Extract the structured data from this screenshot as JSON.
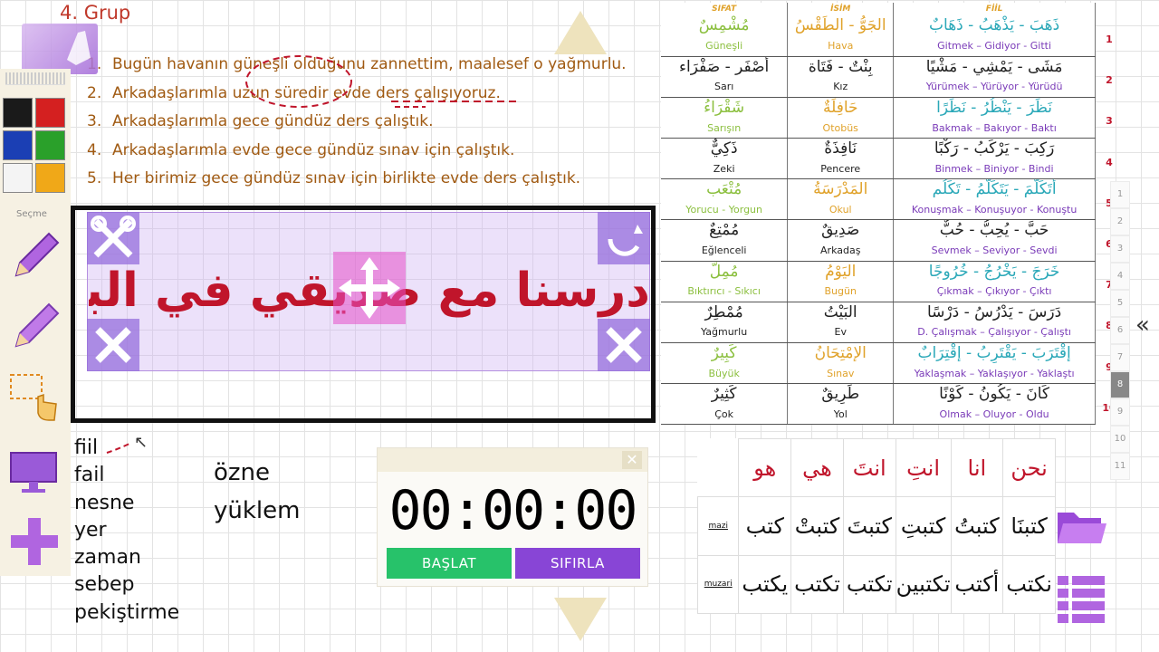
{
  "header": {
    "group_title": "4. Grup"
  },
  "sentences": [
    {
      "num": "1.",
      "text": "Bugün havanın güneşli olduğunu zannettim, maalesef o yağmurlu."
    },
    {
      "num": "2.",
      "text": "Arkadaşlarımla uzun süredir evde ders çalışıyoruz."
    },
    {
      "num": "3.",
      "text": "Arkadaşlarımla gece gündüz ders çalıştık."
    },
    {
      "num": "4.",
      "text": "Arkadaşlarımla evde gece gündüz sınav için çalıştık."
    },
    {
      "num": "5.",
      "text": "Her birimiz gece gündüz sınav için birlikte evde ders çalıştık."
    }
  ],
  "toolbar": {
    "secme_label": "Seçme",
    "colors": [
      "#1a1a1a",
      "#d42020",
      "#1b3fb4",
      "#2aa02a",
      "#f4f4f4",
      "#f0a818"
    ]
  },
  "panel": {
    "arabic_text": "درسنا مع صديقي في البيت ليلاً و نهارًا من أجل الإمتحان"
  },
  "terms": [
    "fiil",
    "fail",
    "nesne",
    "yer",
    "zaman",
    "sebep",
    "pekiştirme"
  ],
  "terms2": [
    "özne",
    "yüklem"
  ],
  "timer": {
    "display": "00:00:00",
    "start_label": "BAŞLAT",
    "reset_label": "SIFIRLA",
    "close_label": "✕",
    "start_color": "#27c26a",
    "reset_color": "#8845d6"
  },
  "vocab": {
    "headers": {
      "sifat": "SIFAT",
      "isim": "İSİM",
      "fiil": "FİİL"
    },
    "rows": [
      {
        "sifat_ar": "مُشْمِسٌ",
        "isim_ar": "الجَوُّ - الطَقْسُ",
        "fiil_ar": "ذَهَبَ - يَذْهَبُ - ذَهَابٌ",
        "sifat_tr": "Güneşli",
        "isim_tr": "Hava",
        "fiil_tr": "Gitmek – Gidiyor - Gitti"
      },
      {
        "sifat_ar": "أَصْفَر - صَفْرَاء",
        "isim_ar": "بِنْتٌ - فَتَاة",
        "fiil_ar": "مَشَى - يَمْشِي - مَشْيًا",
        "sifat_tr": "Sarı",
        "isim_tr": "Kız",
        "fiil_tr": "Yürümek – Yürüyor - Yürüdü"
      },
      {
        "sifat_ar": "شَقْرَاءُ",
        "isim_ar": "حَافِلَةٌ",
        "fiil_ar": "نَظَرَ - يَنْظُرُ - نَظَرًا",
        "sifat_tr": "Sarışın",
        "isim_tr": "Otobüs",
        "fiil_tr": "Bakmak – Bakıyor - Baktı"
      },
      {
        "sifat_ar": "ذَكِيٌّ",
        "isim_ar": "نَافِذَةٌ",
        "fiil_ar": "رَكِبَ - يَرْكَبُ - رَكْبًا",
        "sifat_tr": "Zeki",
        "isim_tr": "Pencere",
        "fiil_tr": "Binmek – Biniyor - Bindi"
      },
      {
        "sifat_ar": "مُتْعَب",
        "isim_ar": "المَدْرَسَةُ",
        "fiil_ar": "أَتَكَلَّمَ - يَتَكَلَّمُ - تَكَلُم",
        "sifat_tr": "Yorucu - Yorgun",
        "isim_tr": "Okul",
        "fiil_tr": "Konuşmak – Konuşuyor - Konuştu"
      },
      {
        "sifat_ar": "مُمْتِعٌ",
        "isim_ar": "صَدِيقٌ",
        "fiil_ar": "حَبَّ - يُحِبُّ - حُبٌّ",
        "sifat_tr": "Eğlenceli",
        "isim_tr": "Arkadaş",
        "fiil_tr": "Sevmek – Seviyor - Sevdi"
      },
      {
        "sifat_ar": "مُمِلٌّ",
        "isim_ar": "اليَوْمُ",
        "fiil_ar": "خَرَجَ - يَخْرُجُ - خُرُوجًا",
        "sifat_tr": "Bıktırıcı - Sıkıcı",
        "isim_tr": "Bugün",
        "fiil_tr": "Çıkmak – Çıkıyor - Çıktı"
      },
      {
        "sifat_ar": "مُمْطِرٌ",
        "isim_ar": "البَيْتُ",
        "fiil_ar": "دَرَسَ - يَدْرُسُ - دَرْسًا",
        "sifat_tr": "Yağmurlu",
        "isim_tr": "Ev",
        "fiil_tr": "D. Çalışmak – Çalışıyor - Çalıştı"
      },
      {
        "sifat_ar": "كَبِيرٌ",
        "isim_ar": "الإمْتِحَانُ",
        "fiil_ar": "إقْتَرَبَ - يَقْتَرِبُ - إقْتِرَابٌ",
        "sifat_tr": "Büyük",
        "isim_tr": "Sınav",
        "fiil_tr": "Yaklaşmak – Yaklaşıyor - Yaklaştı"
      },
      {
        "sifat_ar": "كَثِيرٌ",
        "isim_ar": "طَرِيقٌ",
        "fiil_ar": "كَانَ - يَكُونُ - كَوْنًا",
        "sifat_tr": "Çok",
        "isim_tr": "Yol",
        "fiil_tr": "Olmak – Oluyor - Oldu"
      }
    ],
    "row_numbers": [
      "1",
      "2",
      "3",
      "4",
      "5",
      "6",
      "7",
      "8",
      "9",
      "10"
    ],
    "colors": {
      "green": "#8bbf3e",
      "orange": "#e0a22a",
      "teal": "#2aa8b8",
      "purple": "#7a3bb8"
    }
  },
  "side_numbers": [
    "1",
    "2",
    "3",
    "4",
    "5",
    "6",
    "7",
    "8",
    "9",
    "10",
    "11"
  ],
  "collapse_label": "«",
  "conjugation": {
    "pronouns": [
      "هو",
      "هي",
      "انتَ",
      "انتِ",
      "انا",
      "نحن"
    ],
    "mazi": [
      "كتب",
      "كتبتْ",
      "كتبتَ",
      "كتبتِ",
      "كتبتُ",
      "كتبنَا"
    ],
    "muzari": [
      "يكتب",
      "تكتب",
      "تكتب",
      "تكتبين",
      "أكتب",
      "نكتب"
    ],
    "mazi_label": "mazi",
    "muzari_label": "muzari"
  }
}
